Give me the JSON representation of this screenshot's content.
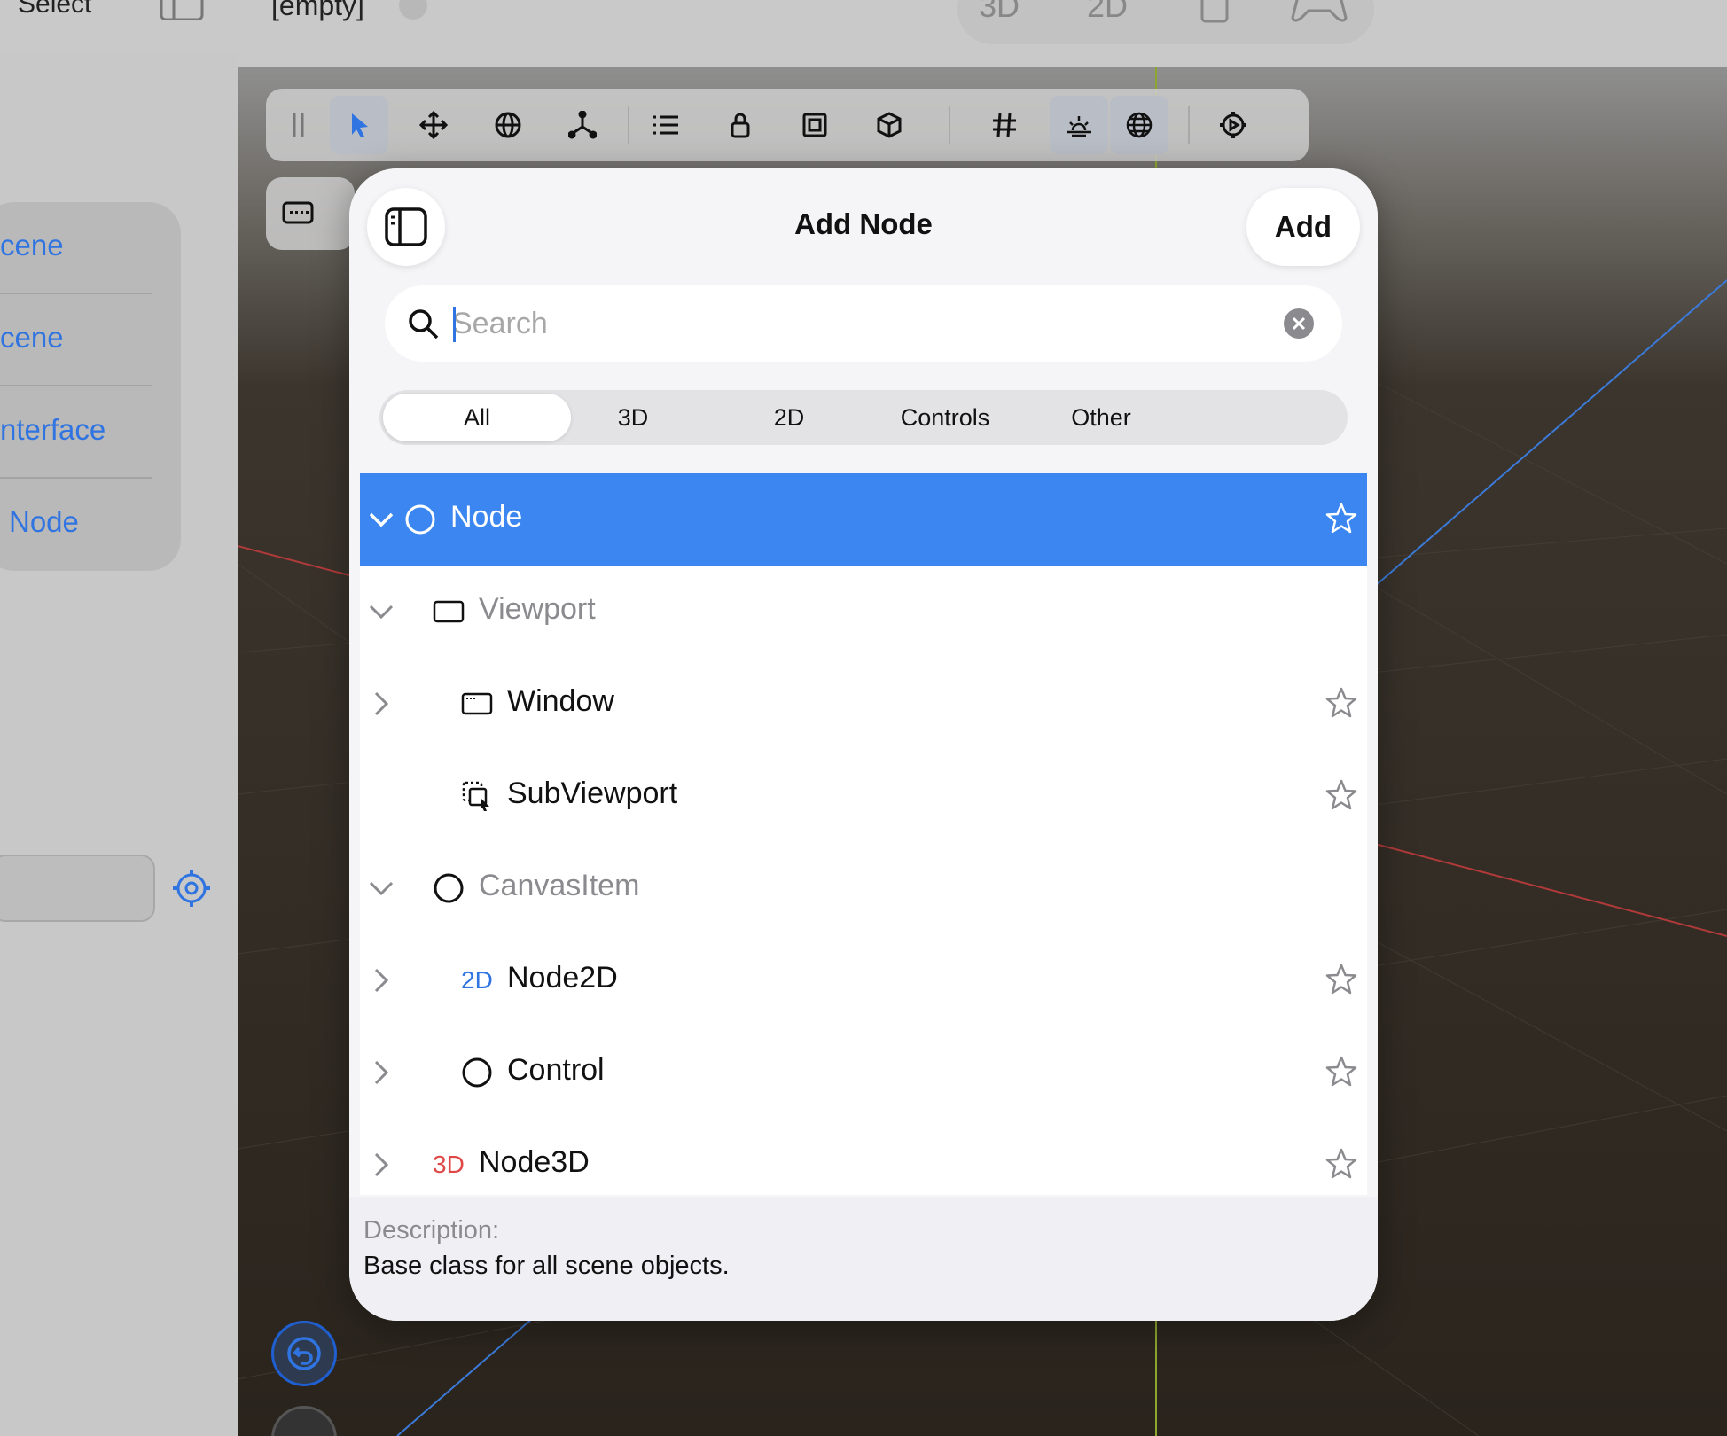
{
  "top_bar": {
    "select_label": "Select",
    "scene_name": "[empty]",
    "mode_3d": "3D",
    "mode_2d": "2D"
  },
  "scene_menu": {
    "items": [
      "cene",
      "cene",
      "nterface",
      "Node"
    ]
  },
  "dialog": {
    "title": "Add Node",
    "add_label": "Add",
    "search_placeholder": "Search",
    "search_value": "",
    "segments": [
      "All",
      "3D",
      "2D",
      "Controls",
      "Other"
    ],
    "selected_segment": "All",
    "nodes": [
      {
        "label": "Node",
        "icon": "circle-icon",
        "expanded": true,
        "selected": true,
        "favorite_star": true,
        "dim": false
      },
      {
        "label": "Viewport",
        "icon": "viewport-icon",
        "expanded": true,
        "selected": false,
        "favorite_star": false,
        "dim": true
      },
      {
        "label": "Window",
        "icon": "window-icon",
        "expanded": false,
        "selected": false,
        "favorite_star": true,
        "dim": false
      },
      {
        "label": "SubViewport",
        "icon": "subviewport-icon",
        "expanded": null,
        "selected": false,
        "favorite_star": true,
        "dim": false
      },
      {
        "label": "CanvasItem",
        "icon": "circle-icon",
        "expanded": true,
        "selected": false,
        "favorite_star": false,
        "dim": true
      },
      {
        "label": "Node2D",
        "icon_text": "2D",
        "icon_color": "#2f74e0",
        "expanded": false,
        "selected": false,
        "favorite_star": true,
        "dim": false
      },
      {
        "label": "Control",
        "icon": "circle-icon",
        "expanded": false,
        "selected": false,
        "favorite_star": true,
        "dim": false
      },
      {
        "label": "Node3D",
        "icon_text": "3D",
        "icon_color": "#e04848",
        "expanded": false,
        "selected": false,
        "favorite_star": true,
        "dim": false
      }
    ],
    "description_label": "Description:",
    "description_text": "Base class for all scene objects."
  },
  "colors": {
    "accent": "#3b86f0",
    "link": "#2f74e0",
    "badge_2d": "#2f74e0",
    "badge_3d": "#e04848"
  }
}
